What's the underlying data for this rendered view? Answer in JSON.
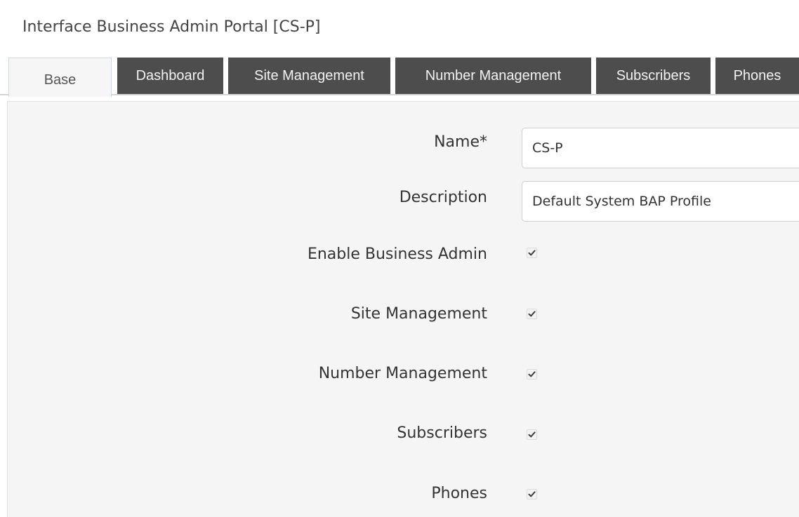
{
  "page": {
    "title": "Interface Business Admin Portal [CS-P]"
  },
  "tabs": [
    {
      "label": "Base",
      "active": true
    },
    {
      "label": "Dashboard",
      "active": false
    },
    {
      "label": "Site Management",
      "active": false
    },
    {
      "label": "Number Management",
      "active": false
    },
    {
      "label": "Subscribers",
      "active": false
    },
    {
      "label": "Phones",
      "active": false
    }
  ],
  "form": {
    "name_label": "Name*",
    "name_value": "CS-P",
    "description_label": "Description",
    "description_value": "Default System BAP Profile",
    "enable_business_admin_label": "Enable Business Admin",
    "enable_business_admin_checked": true,
    "site_management_label": "Site Management",
    "site_management_checked": true,
    "number_management_label": "Number Management",
    "number_management_checked": true,
    "subscribers_label": "Subscribers",
    "subscribers_checked": true,
    "phones_label": "Phones",
    "phones_checked": true
  },
  "icons": {
    "checkbox_checkmark": "checkmark-icon"
  },
  "colors": {
    "tab_background": "#4d4d4d",
    "active_tab_background": "#f6f6f6",
    "panel_background": "#f5f5f5"
  }
}
